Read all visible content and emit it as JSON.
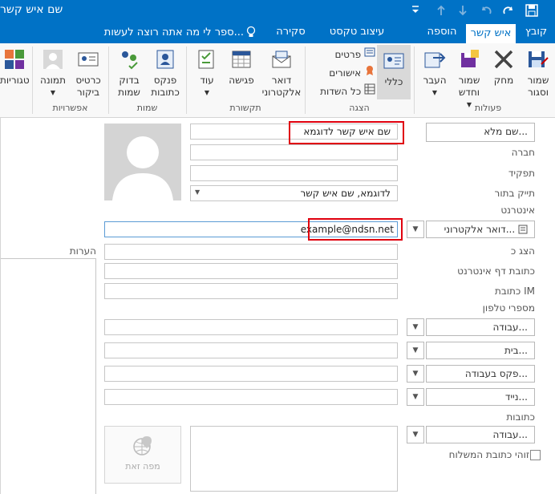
{
  "window": {
    "title": "שם איש קשר"
  },
  "tabs": [
    "קובץ",
    "איש קשר",
    "הוספה",
    "עיצוב טקסט",
    "סקירה"
  ],
  "tell_me": "ספר לי מה אתה רוצה לעשות...",
  "ribbon": {
    "groups": {
      "actions": "פעולות",
      "show": "הצגה",
      "communicate": "תקשורת",
      "names": "שמות",
      "options": "אפשרויות"
    },
    "save_close": "שמור וסגור",
    "delete": "מחק",
    "save_new": "שמור וחדש",
    "forward": "העבר",
    "general": "כללי",
    "details": "פרטים",
    "certificates": "אישורים",
    "all_fields": "כל השדות",
    "email": "דואר אלקטרוני",
    "meeting": "פגישה",
    "more": "עוד",
    "address_book": "פנקס כתובות",
    "check_names": "בדוק שמות",
    "business_card": "כרטיס ביקור",
    "picture": "תמונה",
    "categorize": "חלק לקטגוריות"
  },
  "form": {
    "full_name_button": "שם מלא...",
    "full_name_value": "שם איש קשר לדוגמא",
    "company_label": "חברה",
    "job_title_label": "תפקיד",
    "file_as_label": "תייק בתור",
    "file_as_value": "לדוגמא, שם איש קשר",
    "internet_section": "אינטרנט",
    "email_button": "דואר אלקטרוני...",
    "email_value": "example@ndsn.net",
    "display_as_label": "הצג כ",
    "web_page_label": "כתובת דף אינטרנט",
    "im_label": "כתובת IM",
    "notes_label": "הערות",
    "phone_section": "מספרי טלפון",
    "phones": [
      {
        "label": "עבודה..."
      },
      {
        "label": "בית..."
      },
      {
        "label": "פקס בעבודה..."
      },
      {
        "label": "נייד..."
      }
    ],
    "address_section": "כתובות",
    "address_button": "עבודה...",
    "mailing_address_label": "זוהי כתובת המשלוח",
    "map_label": "מפה זאת"
  }
}
